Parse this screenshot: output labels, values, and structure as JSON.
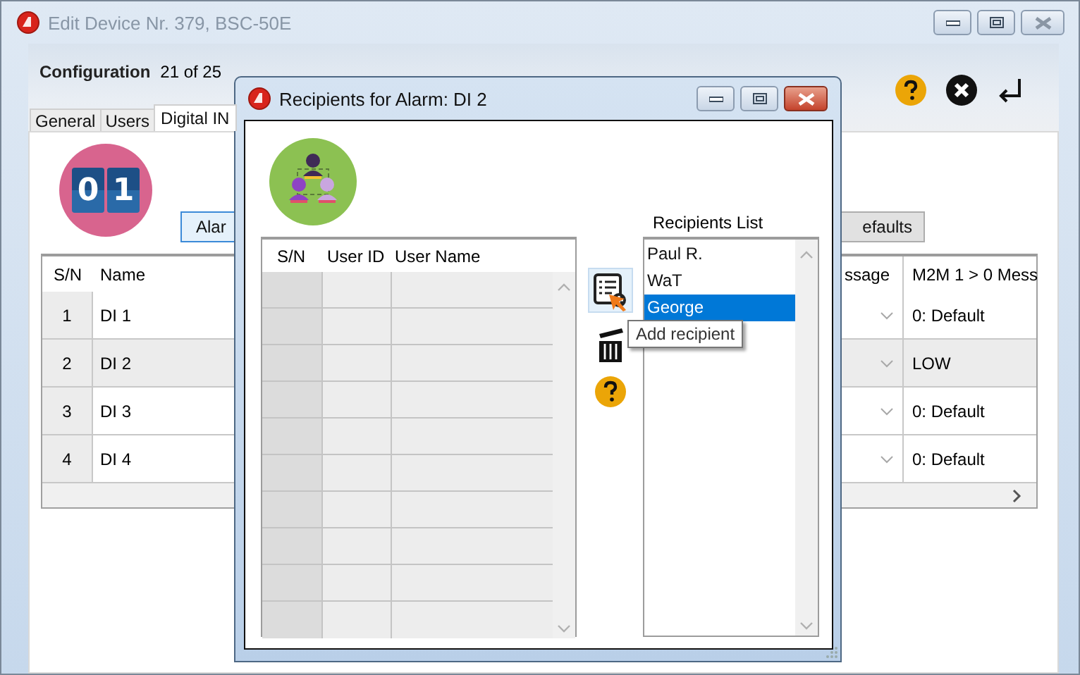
{
  "window": {
    "title": "Edit Device Nr. 379, BSC-50E"
  },
  "configuration": {
    "label": "Configuration",
    "value": "21 of 25"
  },
  "tabs": [
    {
      "label": "General",
      "selected": false
    },
    {
      "label": "Users",
      "selected": false
    },
    {
      "label": "Digital IN",
      "selected": true
    }
  ],
  "panel_icon": {
    "digits": [
      "0",
      "1"
    ]
  },
  "alarm_button": {
    "label": "Alar"
  },
  "defaults_button": {
    "label": "efaults"
  },
  "table": {
    "columns": [
      "S/N",
      "Name",
      "ssage",
      "M2M 1 > 0 Mess"
    ],
    "rows": [
      {
        "sn": "1",
        "name": "DI 1",
        "m2m": "0: Default",
        "selected": false
      },
      {
        "sn": "2",
        "name": "DI 2",
        "m2m": "LOW",
        "selected": true
      },
      {
        "sn": "3",
        "name": "DI 3",
        "m2m": "0: Default",
        "selected": false
      },
      {
        "sn": "4",
        "name": "DI 4",
        "m2m": "0: Default",
        "selected": false
      }
    ]
  },
  "dialog": {
    "title": "Recipients for Alarm: DI 2",
    "users_table": {
      "columns": [
        "S/N",
        "User ID",
        "User Name"
      ]
    },
    "tooltip": "Add recipient",
    "recipients_label": "Recipients List",
    "recipients": [
      {
        "name": "Paul R.",
        "selected": false
      },
      {
        "name": "WaT",
        "selected": false
      },
      {
        "name": "George",
        "selected": true
      }
    ]
  }
}
